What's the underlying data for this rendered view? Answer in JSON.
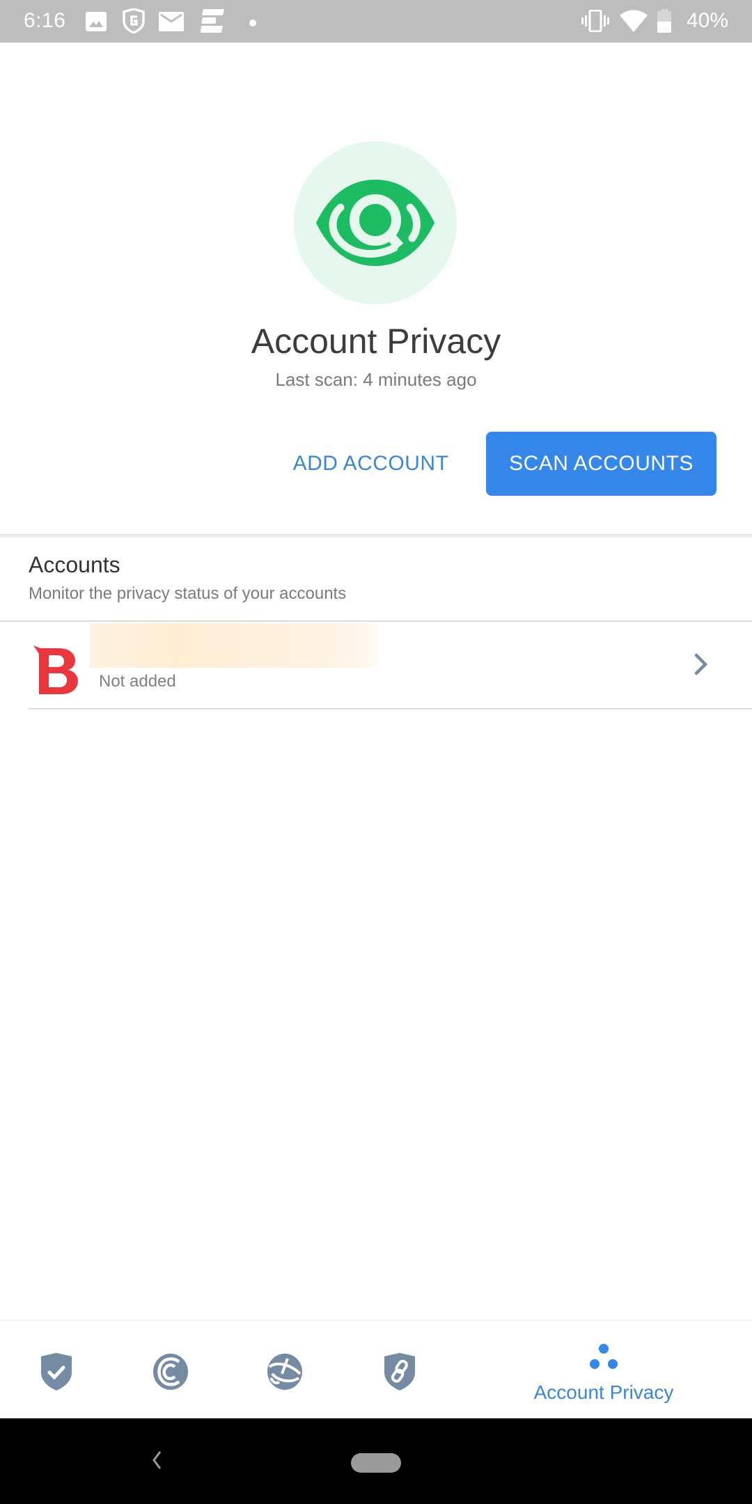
{
  "status_bar": {
    "time": "6:16",
    "left_icons": [
      "image-icon",
      "g-shield-icon",
      "mail-icon",
      "news-icon",
      "dot-icon"
    ],
    "right_icons": [
      "vibrate-icon",
      "wifi-icon",
      "battery-icon"
    ],
    "battery_percent": "40%",
    "battery_level": 0.4
  },
  "header": {
    "icon": "eye-search-icon",
    "title": "Account Privacy",
    "last_scan": "Last scan: 4 minutes ago"
  },
  "actions": {
    "add_account_label": "ADD ACCOUNT",
    "scan_accounts_label": "SCAN ACCOUNTS"
  },
  "accounts": {
    "title": "Accounts",
    "subtitle": "Monitor the privacy status of your accounts",
    "items": [
      {
        "logo_letter": "B",
        "name": "",
        "status": "Not added"
      }
    ]
  },
  "bottom_nav": {
    "items": [
      {
        "icon": "shield-check-icon",
        "label": "",
        "active": false
      },
      {
        "icon": "c-circle-icon",
        "label": "",
        "active": false
      },
      {
        "icon": "globe-icon",
        "label": "",
        "active": false
      },
      {
        "icon": "shield-link-icon",
        "label": "",
        "active": false
      },
      {
        "icon": "three-dots-icon",
        "label": "Account Privacy",
        "active": true
      }
    ]
  },
  "colors": {
    "accent": "#3588ea",
    "accent_text": "#3a86d4",
    "brand_green": "#1dbb62",
    "brand_green_bg": "#e6f7ee",
    "logo_red": "#e8383d",
    "nav_icon": "#758aa3"
  }
}
